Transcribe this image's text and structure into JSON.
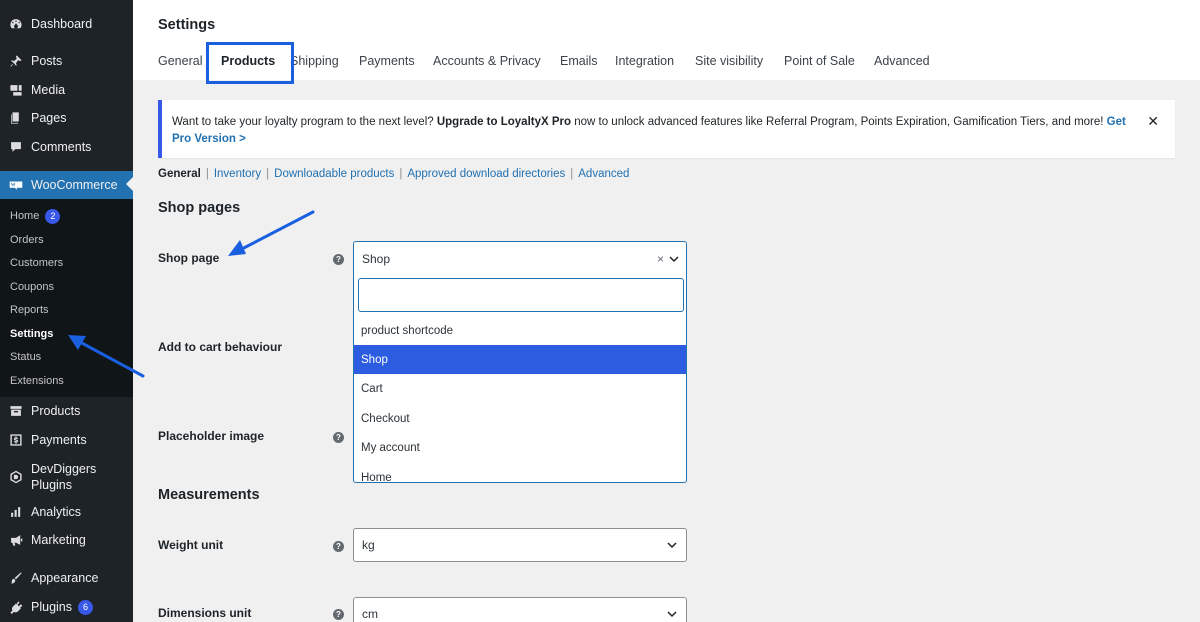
{
  "sidebar": {
    "items": [
      {
        "label": "Dashboard",
        "icon": "dashboard-icon"
      },
      {
        "label": "Posts",
        "icon": "pin-icon"
      },
      {
        "label": "Media",
        "icon": "media-icon"
      },
      {
        "label": "Pages",
        "icon": "pages-icon"
      },
      {
        "label": "Comments",
        "icon": "comment-icon"
      },
      {
        "label": "WooCommerce",
        "icon": "woocommerce-icon"
      },
      {
        "label": "Products",
        "icon": "archive-icon"
      },
      {
        "label": "Payments",
        "icon": "payments-icon"
      },
      {
        "label": "DevDiggers Plugins",
        "icon": "devdiggers-icon"
      },
      {
        "label": "Analytics",
        "icon": "chart-bar-icon"
      },
      {
        "label": "Marketing",
        "icon": "megaphone-icon"
      },
      {
        "label": "Appearance",
        "icon": "brush-icon"
      },
      {
        "label": "Plugins",
        "icon": "plugin-icon",
        "badge": "6"
      }
    ],
    "submenu": [
      {
        "label": "Home",
        "badge": "2"
      },
      {
        "label": "Orders"
      },
      {
        "label": "Customers"
      },
      {
        "label": "Coupons"
      },
      {
        "label": "Reports"
      },
      {
        "label": "Settings",
        "current": true
      },
      {
        "label": "Status"
      },
      {
        "label": "Extensions"
      }
    ]
  },
  "header": {
    "title": "Settings",
    "tabs": [
      "General",
      "Products",
      "Shipping",
      "Payments",
      "Accounts & Privacy",
      "Emails",
      "Integration",
      "Site visibility",
      "Point of Sale",
      "Advanced"
    ],
    "active_tab": "Products"
  },
  "notice": {
    "text_before": "Want to take your loyalty program to the next level? ",
    "bold": "Upgrade to LoyaltyX Pro",
    "text_after": " now to unlock advanced features like Referral Program, Points Expiration, Gamification Tiers, and more! ",
    "link": "Get Pro Version >",
    "close": "✕"
  },
  "subnav": {
    "current": "General",
    "links": [
      "Inventory",
      "Downloadable products",
      "Approved download directories",
      "Advanced"
    ],
    "separator": "|"
  },
  "form": {
    "shop_pages_heading": "Shop pages",
    "shop_page_label": "Shop page",
    "add_to_cart_label": "Add to cart behaviour",
    "placeholder_label": "Placeholder image",
    "measurements_heading": "Measurements",
    "weight_label": "Weight unit",
    "weight_value": "kg",
    "dimensions_label": "Dimensions unit",
    "dimensions_value": "cm",
    "help": "?"
  },
  "dropdown": {
    "current": "Shop",
    "clear": "×",
    "search_value": "",
    "options": [
      "product shortcode",
      "Shop",
      "Cart",
      "Checkout",
      "My account",
      "Home"
    ],
    "selected": "Shop"
  },
  "colors": {
    "admin_sidebar": "#1d2327",
    "submenu": "#101517",
    "accent": "#2271b1",
    "selected_option": "#2c5ce0",
    "annotation": "#1a5fe0",
    "badge": "#3858e9"
  }
}
